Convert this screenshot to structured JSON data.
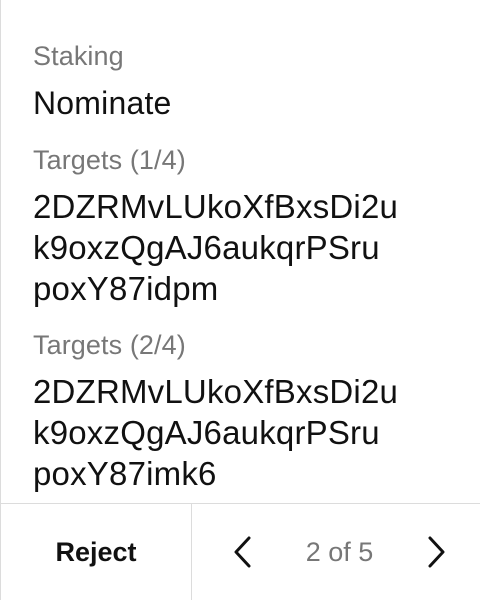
{
  "operation": {
    "section_label": "Staking",
    "title": "Nominate"
  },
  "targets": [
    {
      "label": "Targets (1/4)",
      "lines": [
        "2DZRMvLUkoXfBxsDi2u",
        "k9oxzQgAJ6aukqrPSru",
        "poxY87idpm"
      ]
    },
    {
      "label": "Targets (2/4)",
      "lines": [
        "2DZRMvLUkoXfBxsDi2u",
        "k9oxzQgAJ6aukqrPSru",
        "poxY87imk6"
      ]
    }
  ],
  "footer": {
    "reject_label": "Reject",
    "pager": "2 of 5"
  },
  "icons": {
    "previous": "chevron-left-icon",
    "next": "chevron-right-icon"
  },
  "colors": {
    "text": "#111111",
    "muted": "#777777",
    "divider": "#dcdcdc",
    "background": "#ffffff"
  }
}
